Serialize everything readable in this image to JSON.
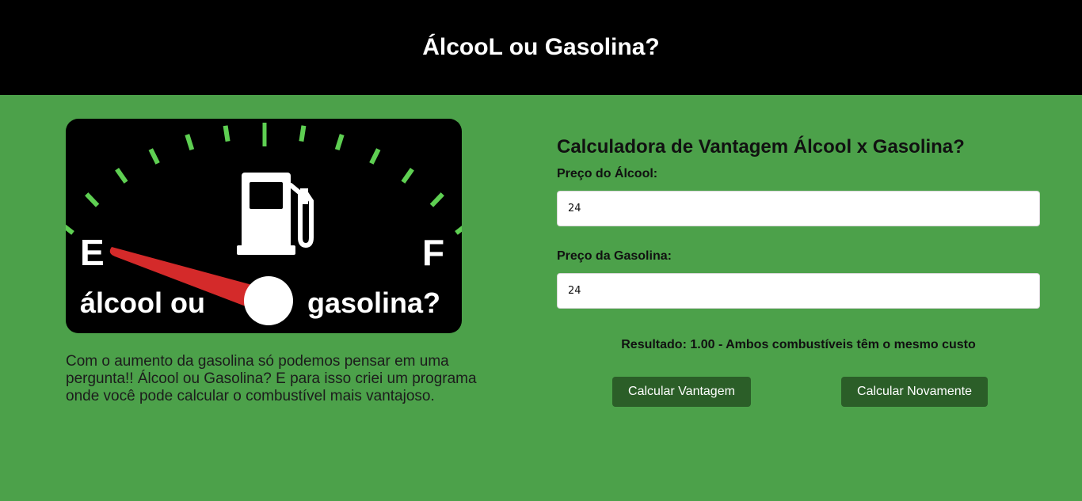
{
  "header": {
    "title": "ÁlcooL ou Gasolina?"
  },
  "gauge": {
    "empty_label": "E",
    "full_label": "F",
    "left_caption": "álcool ou",
    "right_caption": "gasolina?",
    "tick_color": "#5ecf52",
    "needle_color": "#d42a2a"
  },
  "intro": {
    "text": "Com o aumento da gasolina só podemos pensar em uma pergunta!! Álcool ou Gasolina? E para isso criei um programa onde você pode calcular o combustível mais vantajoso."
  },
  "calculator": {
    "title": "Calculadora de Vantagem Álcool x Gasolina?",
    "alcohol_label": "Preço do Álcool:",
    "alcohol_value": "24",
    "gasoline_label": "Preço da Gasolina:",
    "gasoline_value": "24",
    "result_text": "Resultado: 1.00 - Ambos combustíveis têm o mesmo custo",
    "calculate_button": "Calcular Vantagem",
    "recalculate_button": "Calcular Novamente"
  },
  "colors": {
    "page_background": "#4ca14a",
    "header_background": "#000000",
    "button_background": "#2b5e28"
  }
}
